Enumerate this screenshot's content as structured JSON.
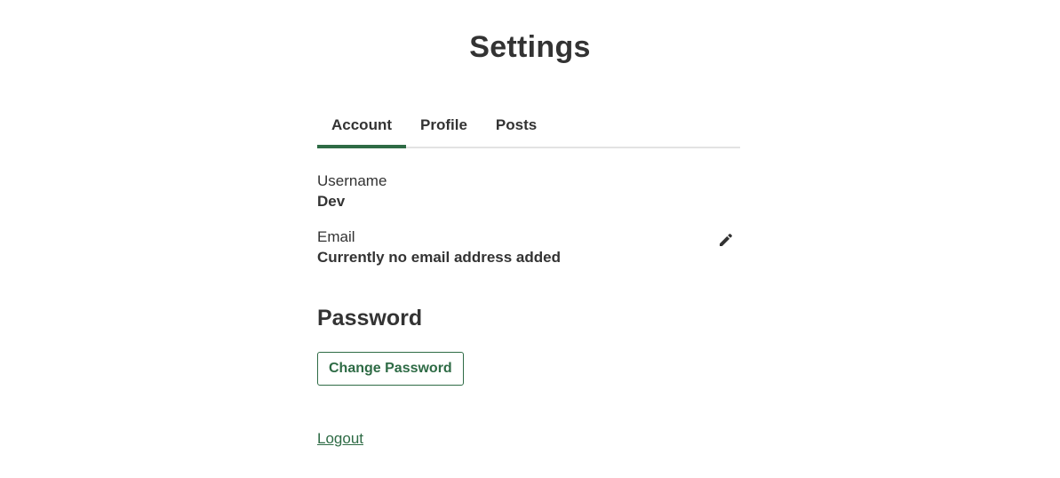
{
  "page": {
    "title": "Settings"
  },
  "tabs": [
    {
      "label": "Account",
      "active": true
    },
    {
      "label": "Profile",
      "active": false
    },
    {
      "label": "Posts",
      "active": false
    }
  ],
  "account": {
    "username": {
      "label": "Username",
      "value": "Dev"
    },
    "email": {
      "label": "Email",
      "value": "Currently no email address added",
      "edit_icon": "pencil-icon"
    }
  },
  "password": {
    "title": "Password",
    "change_label": "Change Password"
  },
  "logout_label": "Logout",
  "colors": {
    "accent": "#2e6b45",
    "text": "#333333",
    "divider": "#e3e3e3"
  }
}
